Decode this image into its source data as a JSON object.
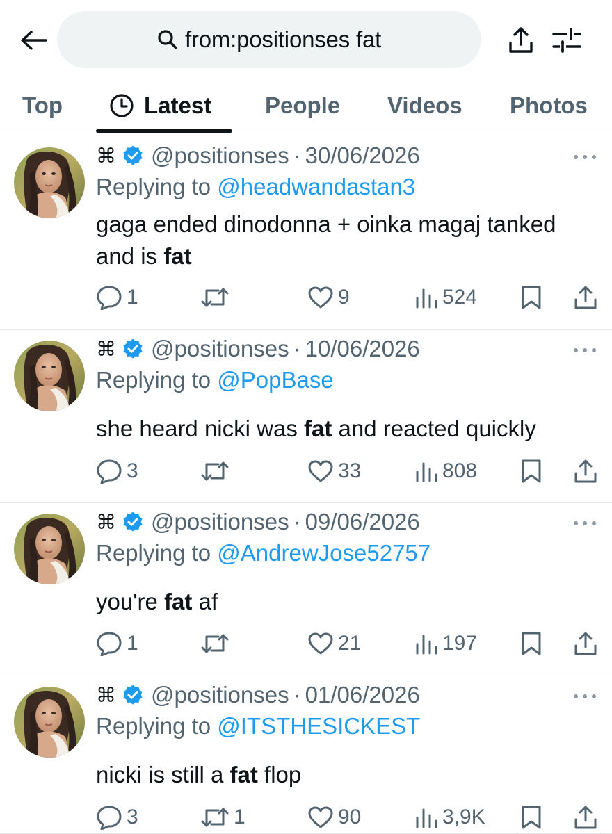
{
  "search": {
    "query": "from:positionses fat"
  },
  "tabs": [
    {
      "label": "Top",
      "active": false
    },
    {
      "label": "Latest",
      "active": true
    },
    {
      "label": "People",
      "active": false
    },
    {
      "label": "Videos",
      "active": false
    },
    {
      "label": "Photos",
      "active": false
    }
  ],
  "colors": {
    "accent": "#1d9bf0",
    "text": "#0f1419",
    "muted": "#536471",
    "divider": "#e6e9eb",
    "pill": "#eff3f4"
  },
  "icons": [
    "back-arrow-icon",
    "search-icon",
    "share-icon",
    "filter-icon",
    "clock-icon",
    "verified-badge-icon",
    "more-icon",
    "reply-icon",
    "retweet-icon",
    "like-icon",
    "views-icon",
    "bookmark-icon"
  ],
  "tweets": [
    {
      "name_mark": "⌘",
      "handle": "@positionses",
      "date": "30/06/2026",
      "replying_prefix": "Replying to ",
      "reply_to": "@headwandastan3",
      "text": [
        {
          "t": "gaga ended dinodonna + oinka magaj tanked and is ",
          "b": false
        },
        {
          "t": "fat",
          "b": true
        }
      ],
      "replies": "1",
      "retweets": "",
      "likes": "9",
      "views": "524"
    },
    {
      "name_mark": "⌘",
      "handle": "@positionses",
      "date": "10/06/2026",
      "replying_prefix": "Replying to ",
      "reply_to": "@PopBase",
      "text": [
        {
          "t": "she heard nicki was ",
          "b": false
        },
        {
          "t": "fat",
          "b": true
        },
        {
          "t": " and reacted quickly",
          "b": false
        }
      ],
      "replies": "3",
      "retweets": "",
      "likes": "33",
      "views": "808"
    },
    {
      "name_mark": "⌘",
      "handle": "@positionses",
      "date": "09/06/2026",
      "replying_prefix": "Replying to ",
      "reply_to": "@AndrewJose52757",
      "text": [
        {
          "t": "you're ",
          "b": false
        },
        {
          "t": "fat",
          "b": true
        },
        {
          "t": " af",
          "b": false
        }
      ],
      "replies": "1",
      "retweets": "",
      "likes": "21",
      "views": "197"
    },
    {
      "name_mark": "⌘",
      "handle": "@positionses",
      "date": "01/06/2026",
      "replying_prefix": "Replying to ",
      "reply_to": "@ITSTHESICKEST",
      "text": [
        {
          "t": "nicki is still a ",
          "b": false
        },
        {
          "t": "fat",
          "b": true
        },
        {
          "t": " flop",
          "b": false
        }
      ],
      "replies": "3",
      "retweets": "1",
      "likes": "90",
      "views": "3,9K"
    }
  ]
}
